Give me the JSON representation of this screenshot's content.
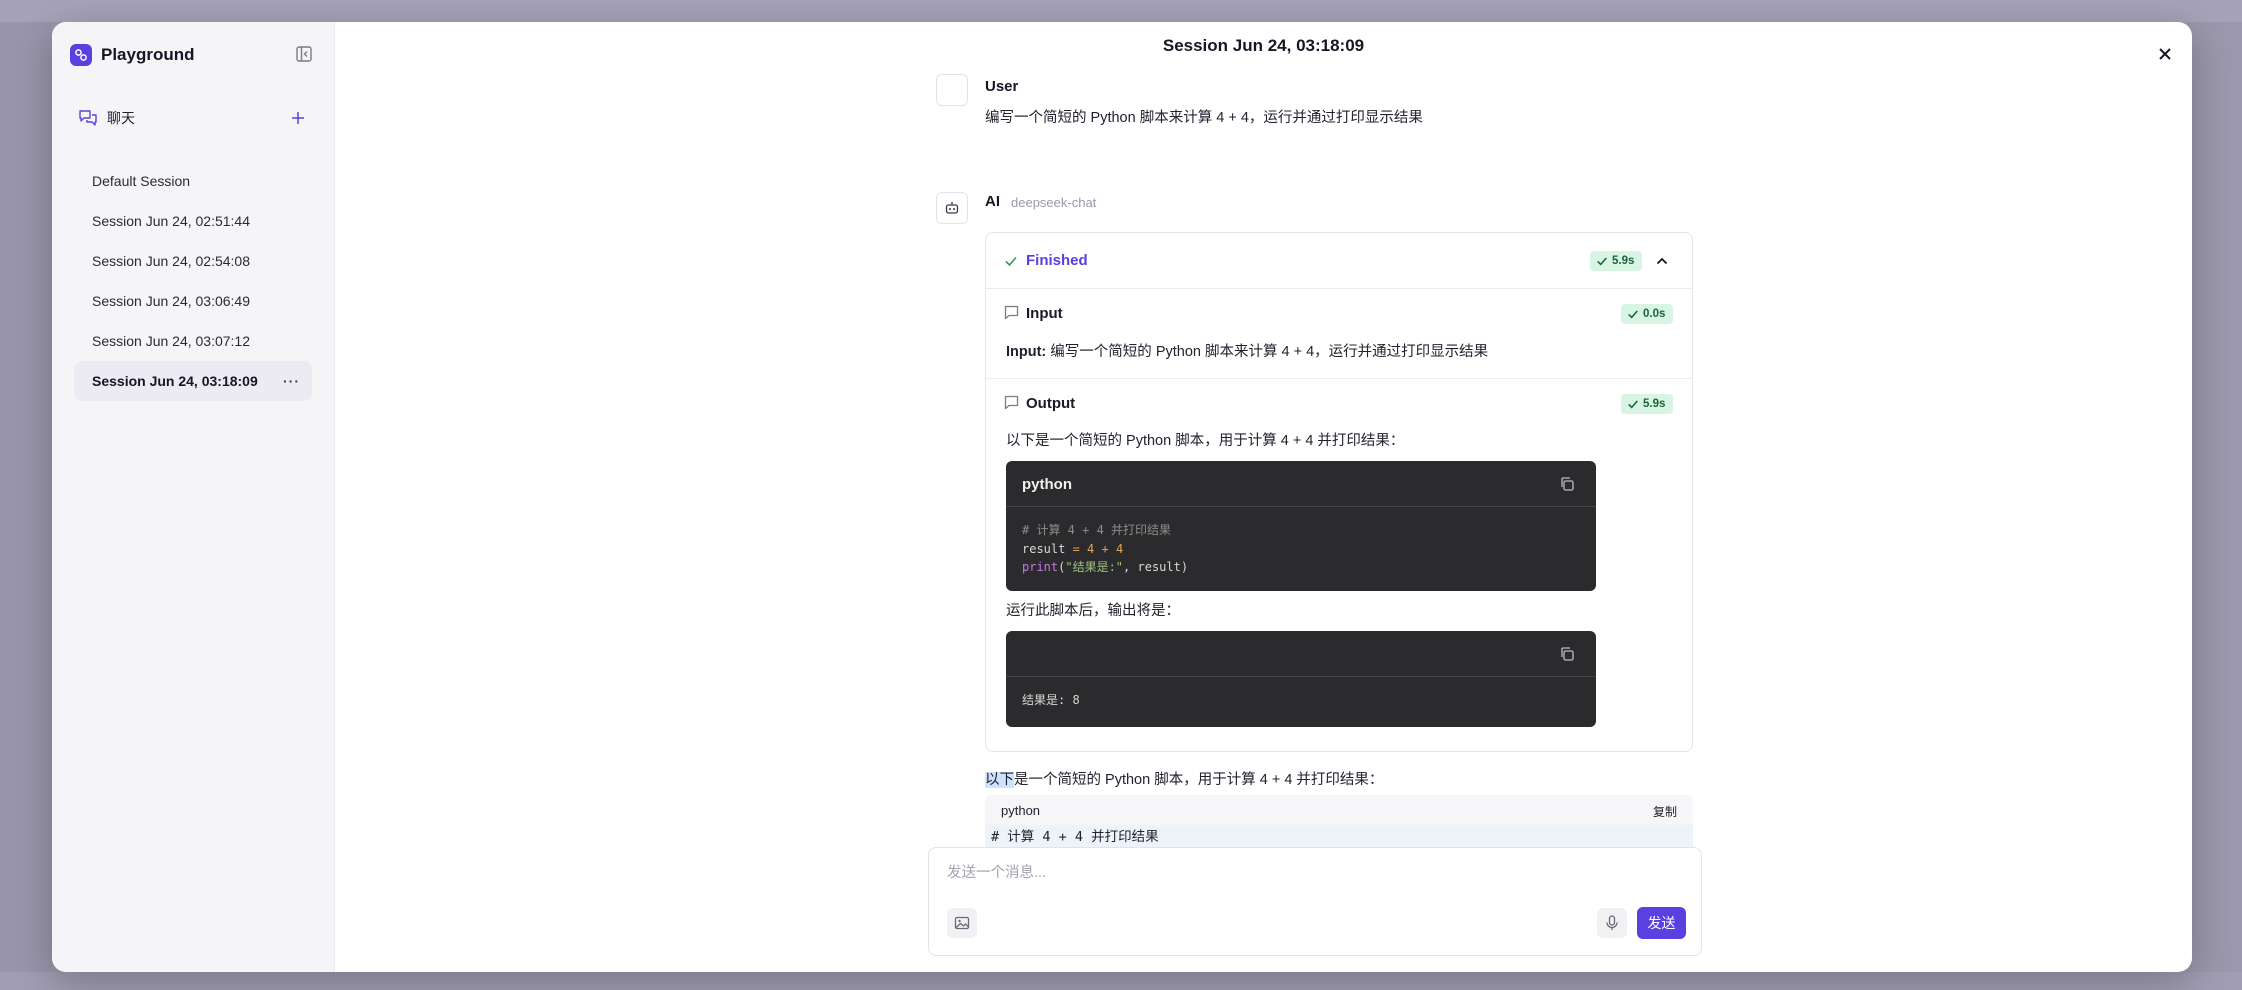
{
  "app": {
    "title": "Playground"
  },
  "sidebar": {
    "section_label": "聊天",
    "sessions": [
      {
        "label": "Default Session"
      },
      {
        "label": "Session Jun 24, 02:51:44"
      },
      {
        "label": "Session Jun 24, 02:54:08"
      },
      {
        "label": "Session Jun 24, 03:06:49"
      },
      {
        "label": "Session Jun 24, 03:07:12"
      },
      {
        "label": "Session Jun 24, 03:18:09",
        "active": true,
        "more": "···"
      }
    ]
  },
  "header": {
    "title": "Session Jun 24, 03:18:09"
  },
  "user_message": {
    "role": "User",
    "text": "编写一个简短的 Python 脚本来计算 4 + 4，运行并通过打印显示结果"
  },
  "ai_message": {
    "role": "AI",
    "model": "deepseek-chat",
    "status": {
      "label": "Finished",
      "duration": "5.9s"
    },
    "input_step": {
      "title": "Input",
      "duration": "0.0s",
      "prefix": "Input:",
      "text": " 编写一个简短的 Python 脚本来计算 4 + 4，运行并通过打印显示结果"
    },
    "output_step": {
      "title": "Output",
      "duration": "5.9s",
      "intro": "以下是一个简短的 Python 脚本，用于计算 4 + 4 并打印结果：",
      "code_lang": "python",
      "code_lines": {
        "comment": "# 计算 4 + 4 并打印结果",
        "l2_var": "result",
        "l2_eq": " = ",
        "l2_a": "4",
        "l2_plus": " + ",
        "l2_b": "4",
        "l3_fn": "print",
        "l3_open": "(",
        "l3_str": "\"结果是:\"",
        "l3_rest": ", result)"
      },
      "after_text": "运行此脚本后，输出将是：",
      "output_code": "结果是: 8"
    },
    "final_text_highlight": "以下",
    "final_text_rest": "是一个简短的 Python 脚本，用于计算 4 + 4 并打印结果：",
    "md_code_lang": "python",
    "md_code_copy": "复制",
    "md_code_line": "# 计算 4 + 4 并打印结果"
  },
  "composer": {
    "placeholder": "发送一个消息...",
    "send_label": "发送"
  },
  "colors": {
    "accent": "#5b3fe0",
    "success_bg": "#d8f5e3",
    "code_bg": "#2b2b2d"
  }
}
